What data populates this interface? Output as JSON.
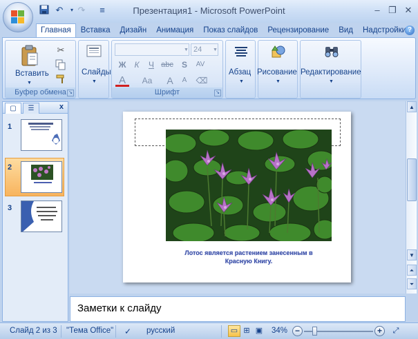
{
  "window": {
    "title": "Презентация1 - Microsoft PowerPoint",
    "minimize": "–",
    "restore": "❐",
    "close": "✕"
  },
  "qat": {
    "customize_icon": "≡"
  },
  "tabs": [
    "Главная",
    "Вставка",
    "Дизайн",
    "Анимация",
    "Показ слайдов",
    "Рецензирование",
    "Вид",
    "Надстройки"
  ],
  "ribbon": {
    "clipboard": {
      "paste_label": "Вставить",
      "group_label": "Буфер обмена"
    },
    "slides": {
      "label": "Слайды"
    },
    "font": {
      "size_value": "24",
      "group_label": "Шрифт",
      "bold": "Ж",
      "italic": "К",
      "underline": "Ч",
      "strike": "abc",
      "shadow": "S",
      "spacing": "AV",
      "color": "A",
      "case": "Aa",
      "grow": "A",
      "shrink": "A"
    },
    "paragraph": {
      "label": "Абзац"
    },
    "drawing": {
      "label": "Рисование"
    },
    "editing": {
      "label": "Редактирование"
    }
  },
  "left_pane": {
    "slides": [
      {
        "number": "1"
      },
      {
        "number": "2"
      },
      {
        "number": "3"
      }
    ]
  },
  "slide": {
    "caption": "Лотос является растением занесенным в Красную Книгу."
  },
  "notes": {
    "placeholder": "Заметки к слайду"
  },
  "status": {
    "slide_info": "Слайд 2 из 3",
    "theme": "\"Тема Office\"",
    "language": "русский",
    "zoom": "34%"
  },
  "colors": {
    "accent": "#15428b",
    "ribbon_bg": "#dfeafa",
    "selection": "#f8b45e"
  }
}
